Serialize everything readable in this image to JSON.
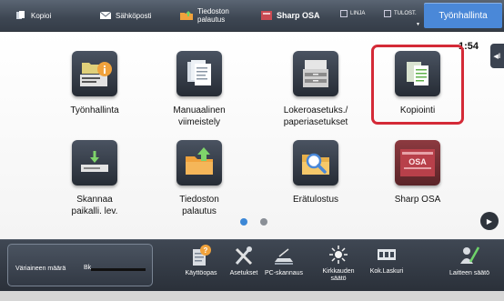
{
  "topbar": {
    "copy_label": "Kopioi",
    "email_label": "Sähköposti",
    "file_retrieve_line1": "Tiedoston",
    "file_retrieve_line2": "palautus",
    "sharp_osa_label": "Sharp OSA",
    "line_label": "LINJA",
    "print_label": "TULOST.",
    "job_status_button": "Työnhallinta"
  },
  "main": {
    "clock": "1:54",
    "tiles": [
      {
        "line1": "Työnhallinta",
        "line2": ""
      },
      {
        "line1": "Manuaalinen",
        "line2": "viimeistely"
      },
      {
        "line1": "Lokeroasetuks./",
        "line2": "paperiasetukset"
      },
      {
        "line1": "Kopiointi",
        "line2": ""
      },
      {
        "line1": "Skannaa",
        "line2": "paikalli. lev."
      },
      {
        "line1": "Tiedoston",
        "line2": "palautus"
      },
      {
        "line1": "Erätulostus",
        "line2": ""
      },
      {
        "line1": "Sharp OSA",
        "line2": ""
      }
    ],
    "page_indicator": {
      "pages": 2,
      "current": 1
    },
    "osa_logo_text": "OSA"
  },
  "bottom": {
    "toner_label": "Väriaineen määrä",
    "toner_color": "Bk",
    "toner_level_fraction": 1.0,
    "buttons": [
      {
        "line1": "Käyttöopas",
        "line2": ""
      },
      {
        "line1": "Asetukset",
        "line2": ""
      },
      {
        "line1": "PC-skannaus",
        "line2": ""
      },
      {
        "line1": "Kirkkauden",
        "line2": "säätö"
      },
      {
        "line1": "Kok.Laskuri",
        "line2": ""
      },
      {
        "line1": "Laitteen säätö",
        "line2": ""
      }
    ]
  },
  "colors": {
    "accent_blue": "#4a88d8",
    "highlight_red": "#d42a37",
    "active_dot": "#3c87d6",
    "inactive_dot": "#8a8f96",
    "icon_orange": "#f0a23c"
  },
  "icons": [
    "copy-icon",
    "email-icon",
    "folder-icon",
    "sharp-osa-icon",
    "job-status-icon",
    "manual-finishing-icon",
    "tray-settings-icon",
    "copy-document-icon",
    "scan-to-hdd-icon",
    "file-retrieve-icon",
    "batch-print-icon",
    "osa-app-icon",
    "user-guide-icon",
    "settings-icon",
    "pc-scan-icon",
    "brightness-icon",
    "counter-icon",
    "device-adjust-icon"
  ]
}
